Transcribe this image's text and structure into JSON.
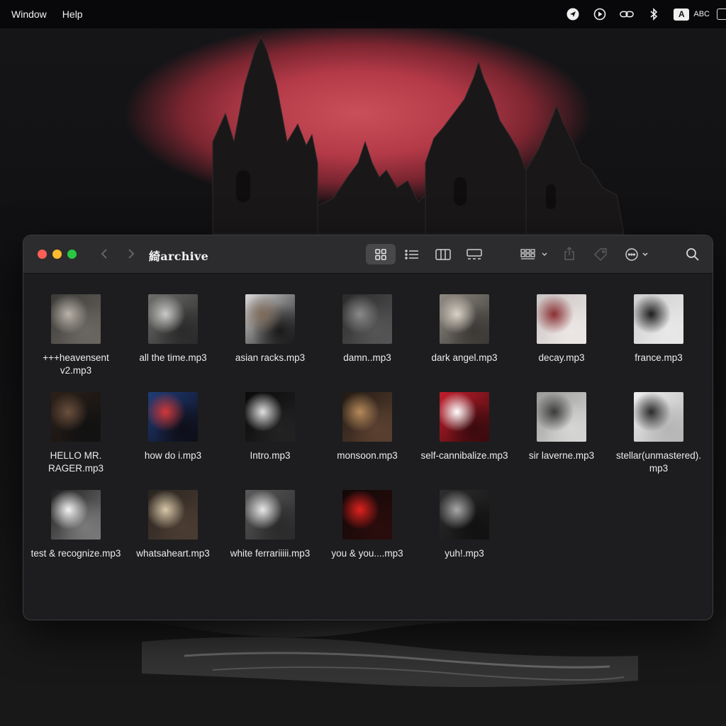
{
  "menubar": {
    "items": [
      {
        "label": "Window"
      },
      {
        "label": "Help"
      }
    ],
    "input_source": {
      "badge": "A",
      "label": "ABC"
    }
  },
  "window": {
    "title": "綺archive",
    "files": [
      {
        "name": "+++heavensent v2.mp3",
        "colors": [
          "#3b3a38",
          "#b8b2a8",
          "#6a6660"
        ]
      },
      {
        "name": "all the time.mp3",
        "colors": [
          "#6e6e6c",
          "#c9c9c7",
          "#2a2a2a"
        ]
      },
      {
        "name": "asian racks.mp3",
        "colors": [
          "#d9d9d9",
          "#7d6a5a",
          "#1a1a1a"
        ]
      },
      {
        "name": "damn..mp3",
        "colors": [
          "#2a2a2a",
          "#8a8a8a",
          "#555555"
        ]
      },
      {
        "name": "dark angel.mp3",
        "colors": [
          "#8f8a82",
          "#d8d2c6",
          "#3b3835"
        ]
      },
      {
        "name": "decay.mp3",
        "colors": [
          "#c9c3c3",
          "#8a2f33",
          "#ece6e4"
        ]
      },
      {
        "name": "france.mp3",
        "colors": [
          "#cfcfcf",
          "#1d1d1d",
          "#e8e8e8"
        ]
      },
      {
        "name": "HELLO MR. RAGER.mp3",
        "colors": [
          "#2b2018",
          "#6b4f3e",
          "#111111"
        ]
      },
      {
        "name": "how do i.mp3",
        "colors": [
          "#1f3c78",
          "#d03838",
          "#0e0e18"
        ]
      },
      {
        "name": "Intro.mp3",
        "colors": [
          "#0a0a0a",
          "#e0e0e0",
          "#222222"
        ]
      },
      {
        "name": "monsoon.mp3",
        "colors": [
          "#231a14",
          "#b58a5a",
          "#5a4030"
        ]
      },
      {
        "name": "self-cannibalize.mp3",
        "colors": [
          "#c21d2a",
          "#ffffff",
          "#3a0a0e"
        ]
      },
      {
        "name": "sir laverne.mp3",
        "colors": [
          "#9a9a98",
          "#3c3c3c",
          "#d6d6d4"
        ]
      },
      {
        "name": "stellar(unmastered).mp3",
        "colors": [
          "#efefef",
          "#2a2a2a",
          "#b5b5b5"
        ]
      },
      {
        "name": "test & recognize.mp3",
        "colors": [
          "#1e1e1e",
          "#f4f4f4",
          "#7a7a7a"
        ]
      },
      {
        "name": "whatsaheart.mp3",
        "colors": [
          "#2b2520",
          "#d8c8a8",
          "#4a3c32"
        ]
      },
      {
        "name": "white ferrariiiii.mp3",
        "colors": [
          "#5a5a5a",
          "#e8e8e8",
          "#2a2a2a"
        ]
      },
      {
        "name": "you & you....mp3",
        "colors": [
          "#120808",
          "#e0221e",
          "#2a0c0c"
        ]
      },
      {
        "name": "yuh!.mp3",
        "colors": [
          "#2e2e2e",
          "#a8a8a8",
          "#111111"
        ]
      }
    ]
  },
  "icons": {
    "nav_back": "chevron-left-icon",
    "nav_forward": "chevron-right-icon",
    "view_icons": "icon-grid-icon",
    "view_list": "list-view-icon",
    "view_columns": "column-view-icon",
    "view_gallery": "gallery-view-icon",
    "group": "group-icon",
    "share": "share-icon",
    "tag": "tag-icon",
    "more": "ellipsis-circle-icon",
    "search": "search-icon"
  },
  "colors": {
    "moon": "#c9505a",
    "window_bg": "#1d1d1f",
    "toolbar_bg": "#2c2c2e",
    "close": "#ff5f57",
    "minimize": "#febc2e",
    "zoom": "#28c840"
  }
}
